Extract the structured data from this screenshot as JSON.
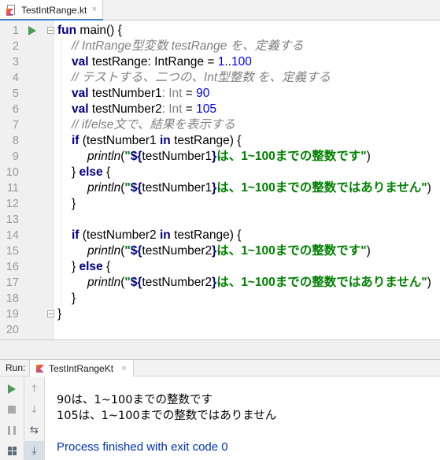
{
  "editor_tab": {
    "file_name": "TestIntRange.kt",
    "close": "×"
  },
  "code_lines": [
    {
      "n": "1",
      "segments": [
        {
          "t": "fun",
          "c": "kw"
        },
        {
          "t": " main() {",
          "c": ""
        }
      ]
    },
    {
      "n": "2",
      "segments": [
        {
          "t": "// IntRange型変数 testRange を、定義する",
          "c": "cm"
        }
      ]
    },
    {
      "n": "3",
      "segments": [
        {
          "t": "val",
          "c": "kw"
        },
        {
          "t": " testRange: IntRange = ",
          "c": ""
        },
        {
          "t": "1",
          "c": "num"
        },
        {
          "t": "..",
          "c": ""
        },
        {
          "t": "100",
          "c": "num"
        }
      ]
    },
    {
      "n": "4",
      "segments": [
        {
          "t": "// テストする、二つの、Int型整数 を、定義する",
          "c": "cm"
        }
      ]
    },
    {
      "n": "5",
      "segments": [
        {
          "t": "val",
          "c": "kw"
        },
        {
          "t": " testNumber1",
          "c": ""
        },
        {
          "t": ": Int",
          "c": "hint"
        },
        {
          "t": " = ",
          "c": ""
        },
        {
          "t": "90",
          "c": "num"
        }
      ]
    },
    {
      "n": "6",
      "segments": [
        {
          "t": "val",
          "c": "kw"
        },
        {
          "t": " testNumber2",
          "c": ""
        },
        {
          "t": ": Int",
          "c": "hint"
        },
        {
          "t": " = ",
          "c": ""
        },
        {
          "t": "105",
          "c": "num"
        }
      ]
    },
    {
      "n": "7",
      "segments": [
        {
          "t": "// if/else文で、結果を表示する",
          "c": "cm"
        }
      ]
    },
    {
      "n": "8",
      "segments": [
        {
          "t": "if",
          "c": "kw"
        },
        {
          "t": " (testNumber1 ",
          "c": ""
        },
        {
          "t": "in",
          "c": "kw"
        },
        {
          "t": " testRange) {",
          "c": ""
        }
      ]
    },
    {
      "n": "9",
      "segments": [
        {
          "t": "println",
          "c": "fn"
        },
        {
          "t": "(",
          "c": ""
        },
        {
          "t": "\"",
          "c": "str"
        },
        {
          "t": "${",
          "c": "tpl"
        },
        {
          "t": "testNumber1",
          "c": ""
        },
        {
          "t": "}",
          "c": "tpl"
        },
        {
          "t": "は、1~100までの整数です\"",
          "c": "str"
        },
        {
          "t": ")",
          "c": ""
        }
      ]
    },
    {
      "n": "10",
      "segments": [
        {
          "t": "} ",
          "c": ""
        },
        {
          "t": "else",
          "c": "kw"
        },
        {
          "t": " {",
          "c": ""
        }
      ]
    },
    {
      "n": "11",
      "segments": [
        {
          "t": "println",
          "c": "fn"
        },
        {
          "t": "(",
          "c": ""
        },
        {
          "t": "\"",
          "c": "str"
        },
        {
          "t": "${",
          "c": "tpl"
        },
        {
          "t": "testNumber1",
          "c": ""
        },
        {
          "t": "}",
          "c": "tpl"
        },
        {
          "t": "は、1~100までの整数ではありません\"",
          "c": "str"
        },
        {
          "t": ")",
          "c": ""
        }
      ]
    },
    {
      "n": "12",
      "segments": [
        {
          "t": "}",
          "c": ""
        }
      ]
    },
    {
      "n": "13",
      "segments": []
    },
    {
      "n": "14",
      "segments": [
        {
          "t": "if",
          "c": "kw"
        },
        {
          "t": " (testNumber2 ",
          "c": ""
        },
        {
          "t": "in",
          "c": "kw"
        },
        {
          "t": " testRange) {",
          "c": ""
        }
      ]
    },
    {
      "n": "15",
      "segments": [
        {
          "t": "println",
          "c": "fn"
        },
        {
          "t": "(",
          "c": ""
        },
        {
          "t": "\"",
          "c": "str"
        },
        {
          "t": "${",
          "c": "tpl"
        },
        {
          "t": "testNumber2",
          "c": ""
        },
        {
          "t": "}",
          "c": "tpl"
        },
        {
          "t": "は、1~100までの整数です\"",
          "c": "str"
        },
        {
          "t": ")",
          "c": ""
        }
      ]
    },
    {
      "n": "16",
      "segments": [
        {
          "t": "} ",
          "c": ""
        },
        {
          "t": "else",
          "c": "kw"
        },
        {
          "t": " {",
          "c": ""
        }
      ]
    },
    {
      "n": "17",
      "segments": [
        {
          "t": "println",
          "c": "fn"
        },
        {
          "t": "(",
          "c": ""
        },
        {
          "t": "\"",
          "c": "str"
        },
        {
          "t": "${",
          "c": "tpl"
        },
        {
          "t": "testNumber2",
          "c": ""
        },
        {
          "t": "}",
          "c": "tpl"
        },
        {
          "t": "は、1~100までの整数ではありません\"",
          "c": "str"
        },
        {
          "t": ")",
          "c": ""
        }
      ]
    },
    {
      "n": "18",
      "segments": [
        {
          "t": "}",
          "c": ""
        }
      ]
    },
    {
      "n": "19",
      "segments": [
        {
          "t": "}",
          "c": ""
        }
      ]
    },
    {
      "n": "20",
      "segments": []
    }
  ],
  "gutter_icons": {
    "run": "run-arrow-icon",
    "fold": "fold-marker-icon"
  },
  "run_panel": {
    "title": "Run:",
    "tab_label": "TestIntRangeKt",
    "tab_close": "×",
    "output": [
      "90は、1~100までの整数です",
      "105は、1~100までの整数ではありません"
    ],
    "exit_message": "Process finished with exit code 0"
  },
  "colors": {
    "keyword": "#000080",
    "comment": "#808080",
    "number": "#0000ff",
    "string": "#008000",
    "run_green": "#499c54",
    "process_text": "#0033b3"
  }
}
